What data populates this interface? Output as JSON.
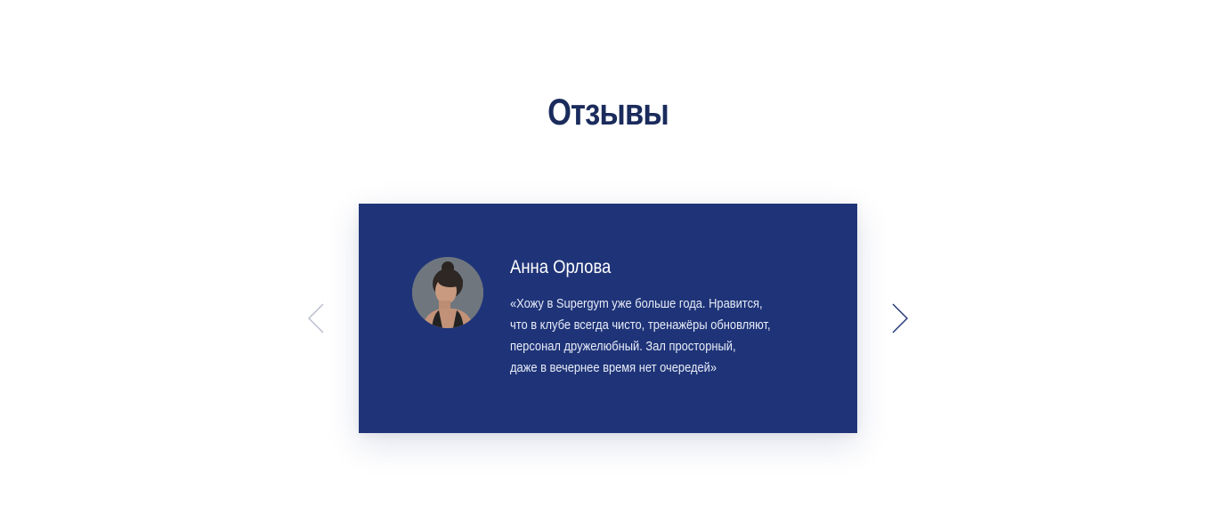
{
  "section": {
    "title": "Отзывы"
  },
  "slider": {
    "prev_icon": "chevron-left-icon",
    "next_icon": "chevron-right-icon",
    "review": {
      "name": "Анна Орлова",
      "avatar_icon": "avatar-photo",
      "text_lines": [
        "«Хожу в Supergym уже больше года. Нравится,",
        "что в клубе всегда чисто, тренажёры обновляют,",
        "персонал дружелюбный. Зал просторный,",
        "даже в вечернее время нет очередей»"
      ]
    }
  },
  "colors": {
    "title": "#1a2b5c",
    "card_background": "#1f3478",
    "card_text": "#ffffff",
    "arrow_prev": "#b7bccb",
    "arrow_next": "#1f3478"
  }
}
